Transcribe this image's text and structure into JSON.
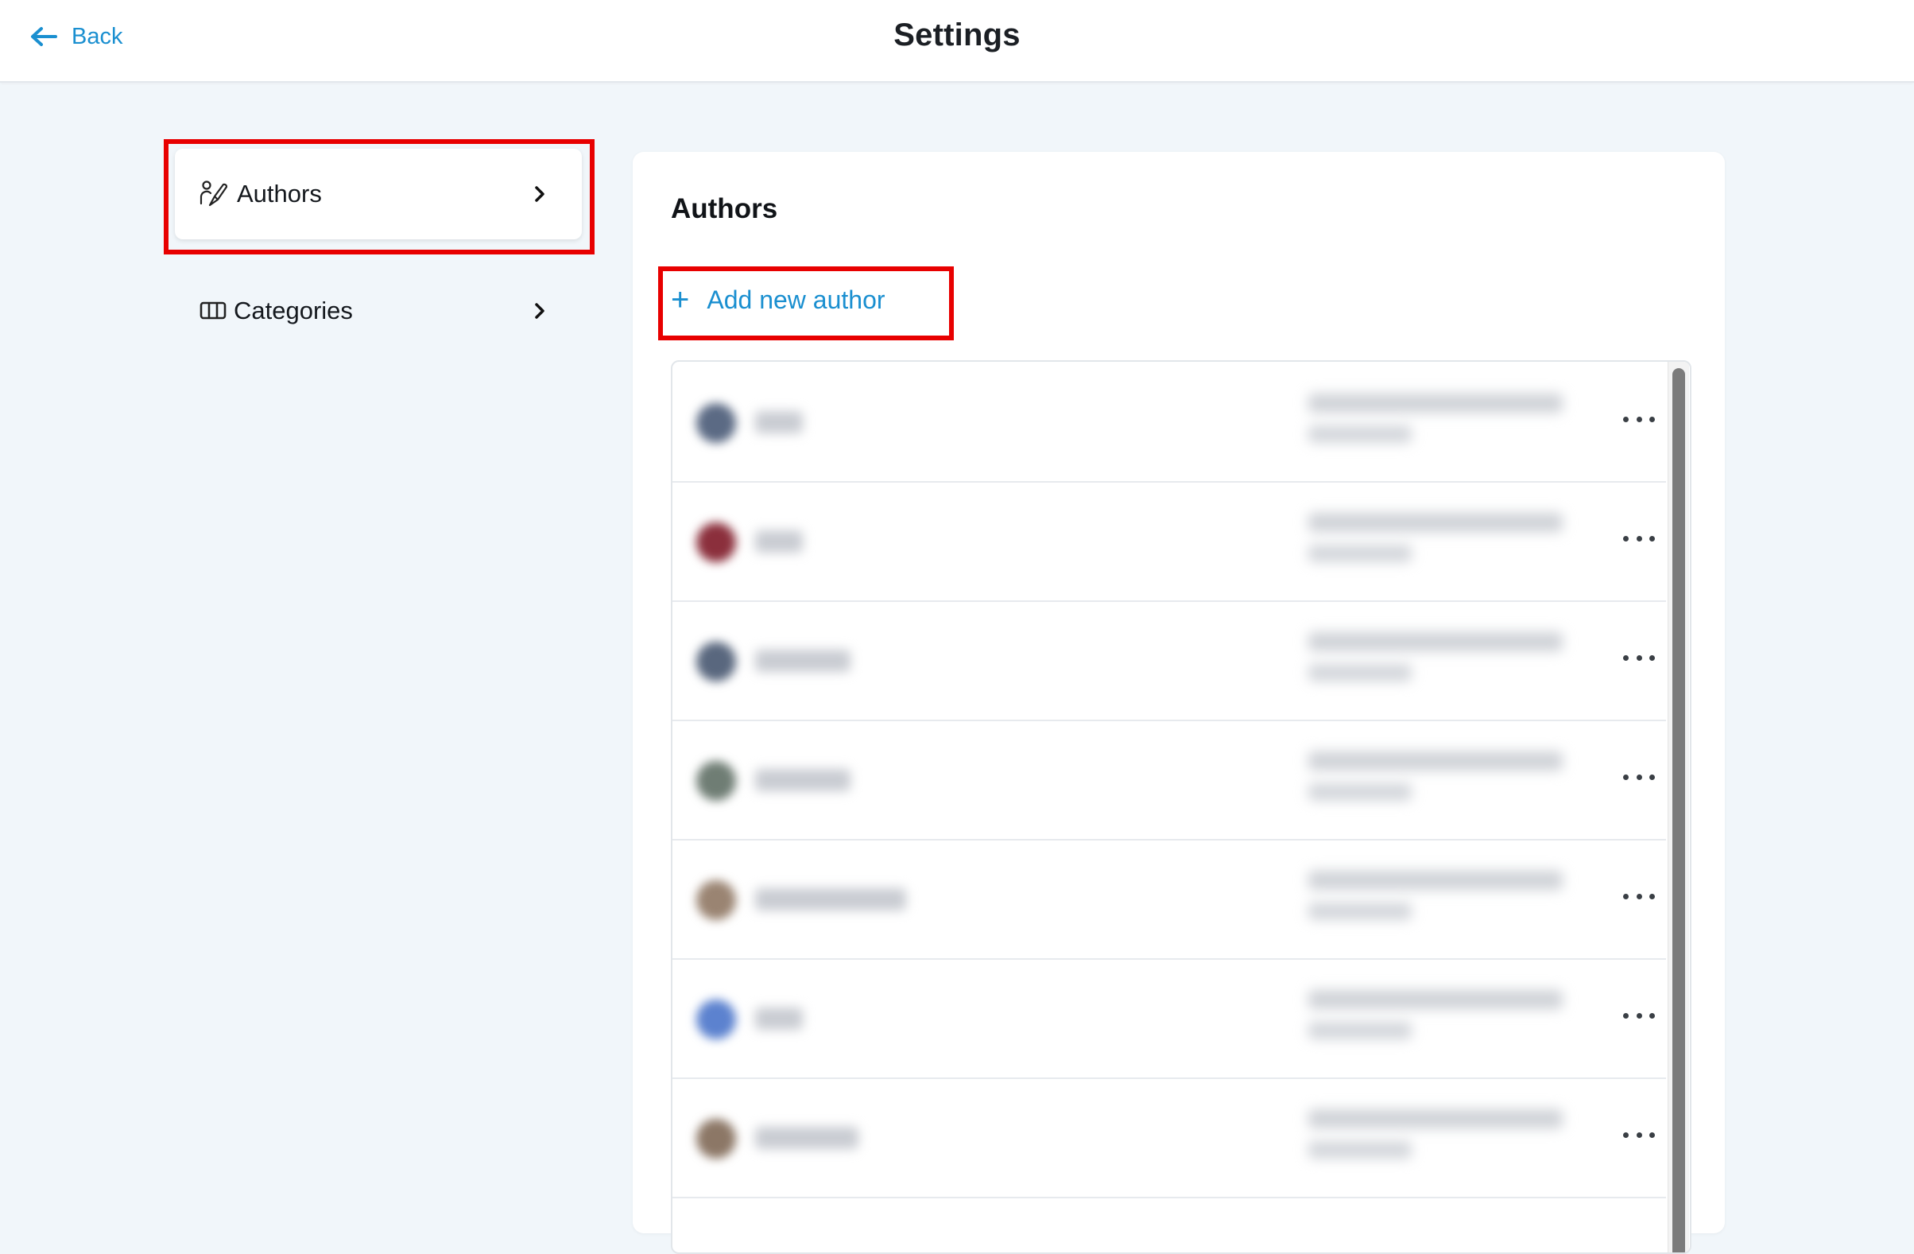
{
  "header": {
    "back_label": "Back",
    "title": "Settings"
  },
  "sidebar": {
    "items": [
      {
        "label": "Authors",
        "icon": "authors-icon",
        "active": true
      },
      {
        "label": "Categories",
        "icon": "columns-icon",
        "active": false
      }
    ]
  },
  "main": {
    "title": "Authors",
    "add_label": "Add new author",
    "rows_note": "author names and metadata are blurred in the screenshot",
    "row_count": 7,
    "row_avatar_colors": [
      "#5b6a84",
      "#8b2f3c",
      "#59677e",
      "#6f7d74",
      "#9a8472",
      "#5c82cf",
      "#8c7766"
    ]
  },
  "colors": {
    "accent": "#1a8fd0",
    "highlight": "#e80000",
    "background": "#f1f6fa"
  }
}
